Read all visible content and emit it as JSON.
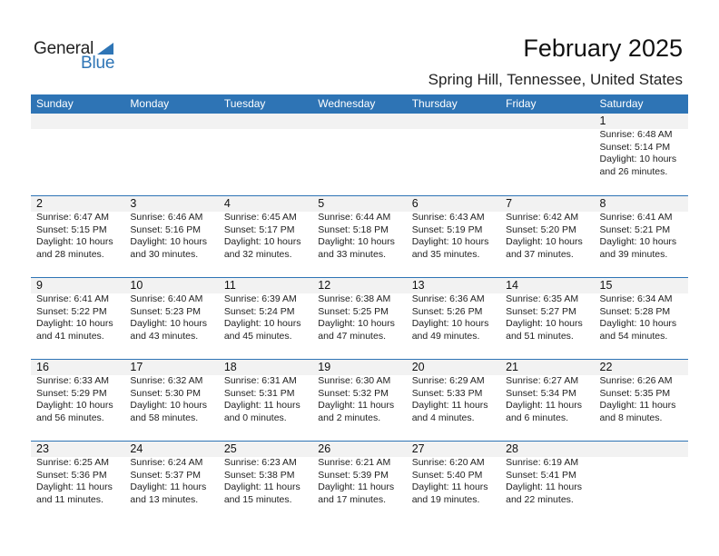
{
  "logo": {
    "general": "General",
    "blue": "Blue"
  },
  "header": {
    "title": "February 2025",
    "location": "Spring Hill, Tennessee, United States"
  },
  "colors": {
    "accent": "#2e74b5",
    "strip": "#f2f2f2"
  },
  "weekdays": [
    "Sunday",
    "Monday",
    "Tuesday",
    "Wednesday",
    "Thursday",
    "Friday",
    "Saturday"
  ],
  "weeks": [
    [
      null,
      null,
      null,
      null,
      null,
      null,
      {
        "day": "1",
        "sunrise": "Sunrise: 6:48 AM",
        "sunset": "Sunset: 5:14 PM",
        "daylight1": "Daylight: 10 hours",
        "daylight2": "and 26 minutes."
      }
    ],
    [
      {
        "day": "2",
        "sunrise": "Sunrise: 6:47 AM",
        "sunset": "Sunset: 5:15 PM",
        "daylight1": "Daylight: 10 hours",
        "daylight2": "and 28 minutes."
      },
      {
        "day": "3",
        "sunrise": "Sunrise: 6:46 AM",
        "sunset": "Sunset: 5:16 PM",
        "daylight1": "Daylight: 10 hours",
        "daylight2": "and 30 minutes."
      },
      {
        "day": "4",
        "sunrise": "Sunrise: 6:45 AM",
        "sunset": "Sunset: 5:17 PM",
        "daylight1": "Daylight: 10 hours",
        "daylight2": "and 32 minutes."
      },
      {
        "day": "5",
        "sunrise": "Sunrise: 6:44 AM",
        "sunset": "Sunset: 5:18 PM",
        "daylight1": "Daylight: 10 hours",
        "daylight2": "and 33 minutes."
      },
      {
        "day": "6",
        "sunrise": "Sunrise: 6:43 AM",
        "sunset": "Sunset: 5:19 PM",
        "daylight1": "Daylight: 10 hours",
        "daylight2": "and 35 minutes."
      },
      {
        "day": "7",
        "sunrise": "Sunrise: 6:42 AM",
        "sunset": "Sunset: 5:20 PM",
        "daylight1": "Daylight: 10 hours",
        "daylight2": "and 37 minutes."
      },
      {
        "day": "8",
        "sunrise": "Sunrise: 6:41 AM",
        "sunset": "Sunset: 5:21 PM",
        "daylight1": "Daylight: 10 hours",
        "daylight2": "and 39 minutes."
      }
    ],
    [
      {
        "day": "9",
        "sunrise": "Sunrise: 6:41 AM",
        "sunset": "Sunset: 5:22 PM",
        "daylight1": "Daylight: 10 hours",
        "daylight2": "and 41 minutes."
      },
      {
        "day": "10",
        "sunrise": "Sunrise: 6:40 AM",
        "sunset": "Sunset: 5:23 PM",
        "daylight1": "Daylight: 10 hours",
        "daylight2": "and 43 minutes."
      },
      {
        "day": "11",
        "sunrise": "Sunrise: 6:39 AM",
        "sunset": "Sunset: 5:24 PM",
        "daylight1": "Daylight: 10 hours",
        "daylight2": "and 45 minutes."
      },
      {
        "day": "12",
        "sunrise": "Sunrise: 6:38 AM",
        "sunset": "Sunset: 5:25 PM",
        "daylight1": "Daylight: 10 hours",
        "daylight2": "and 47 minutes."
      },
      {
        "day": "13",
        "sunrise": "Sunrise: 6:36 AM",
        "sunset": "Sunset: 5:26 PM",
        "daylight1": "Daylight: 10 hours",
        "daylight2": "and 49 minutes."
      },
      {
        "day": "14",
        "sunrise": "Sunrise: 6:35 AM",
        "sunset": "Sunset: 5:27 PM",
        "daylight1": "Daylight: 10 hours",
        "daylight2": "and 51 minutes."
      },
      {
        "day": "15",
        "sunrise": "Sunrise: 6:34 AM",
        "sunset": "Sunset: 5:28 PM",
        "daylight1": "Daylight: 10 hours",
        "daylight2": "and 54 minutes."
      }
    ],
    [
      {
        "day": "16",
        "sunrise": "Sunrise: 6:33 AM",
        "sunset": "Sunset: 5:29 PM",
        "daylight1": "Daylight: 10 hours",
        "daylight2": "and 56 minutes."
      },
      {
        "day": "17",
        "sunrise": "Sunrise: 6:32 AM",
        "sunset": "Sunset: 5:30 PM",
        "daylight1": "Daylight: 10 hours",
        "daylight2": "and 58 minutes."
      },
      {
        "day": "18",
        "sunrise": "Sunrise: 6:31 AM",
        "sunset": "Sunset: 5:31 PM",
        "daylight1": "Daylight: 11 hours",
        "daylight2": "and 0 minutes."
      },
      {
        "day": "19",
        "sunrise": "Sunrise: 6:30 AM",
        "sunset": "Sunset: 5:32 PM",
        "daylight1": "Daylight: 11 hours",
        "daylight2": "and 2 minutes."
      },
      {
        "day": "20",
        "sunrise": "Sunrise: 6:29 AM",
        "sunset": "Sunset: 5:33 PM",
        "daylight1": "Daylight: 11 hours",
        "daylight2": "and 4 minutes."
      },
      {
        "day": "21",
        "sunrise": "Sunrise: 6:27 AM",
        "sunset": "Sunset: 5:34 PM",
        "daylight1": "Daylight: 11 hours",
        "daylight2": "and 6 minutes."
      },
      {
        "day": "22",
        "sunrise": "Sunrise: 6:26 AM",
        "sunset": "Sunset: 5:35 PM",
        "daylight1": "Daylight: 11 hours",
        "daylight2": "and 8 minutes."
      }
    ],
    [
      {
        "day": "23",
        "sunrise": "Sunrise: 6:25 AM",
        "sunset": "Sunset: 5:36 PM",
        "daylight1": "Daylight: 11 hours",
        "daylight2": "and 11 minutes."
      },
      {
        "day": "24",
        "sunrise": "Sunrise: 6:24 AM",
        "sunset": "Sunset: 5:37 PM",
        "daylight1": "Daylight: 11 hours",
        "daylight2": "and 13 minutes."
      },
      {
        "day": "25",
        "sunrise": "Sunrise: 6:23 AM",
        "sunset": "Sunset: 5:38 PM",
        "daylight1": "Daylight: 11 hours",
        "daylight2": "and 15 minutes."
      },
      {
        "day": "26",
        "sunrise": "Sunrise: 6:21 AM",
        "sunset": "Sunset: 5:39 PM",
        "daylight1": "Daylight: 11 hours",
        "daylight2": "and 17 minutes."
      },
      {
        "day": "27",
        "sunrise": "Sunrise: 6:20 AM",
        "sunset": "Sunset: 5:40 PM",
        "daylight1": "Daylight: 11 hours",
        "daylight2": "and 19 minutes."
      },
      {
        "day": "28",
        "sunrise": "Sunrise: 6:19 AM",
        "sunset": "Sunset: 5:41 PM",
        "daylight1": "Daylight: 11 hours",
        "daylight2": "and 22 minutes."
      },
      null
    ]
  ]
}
